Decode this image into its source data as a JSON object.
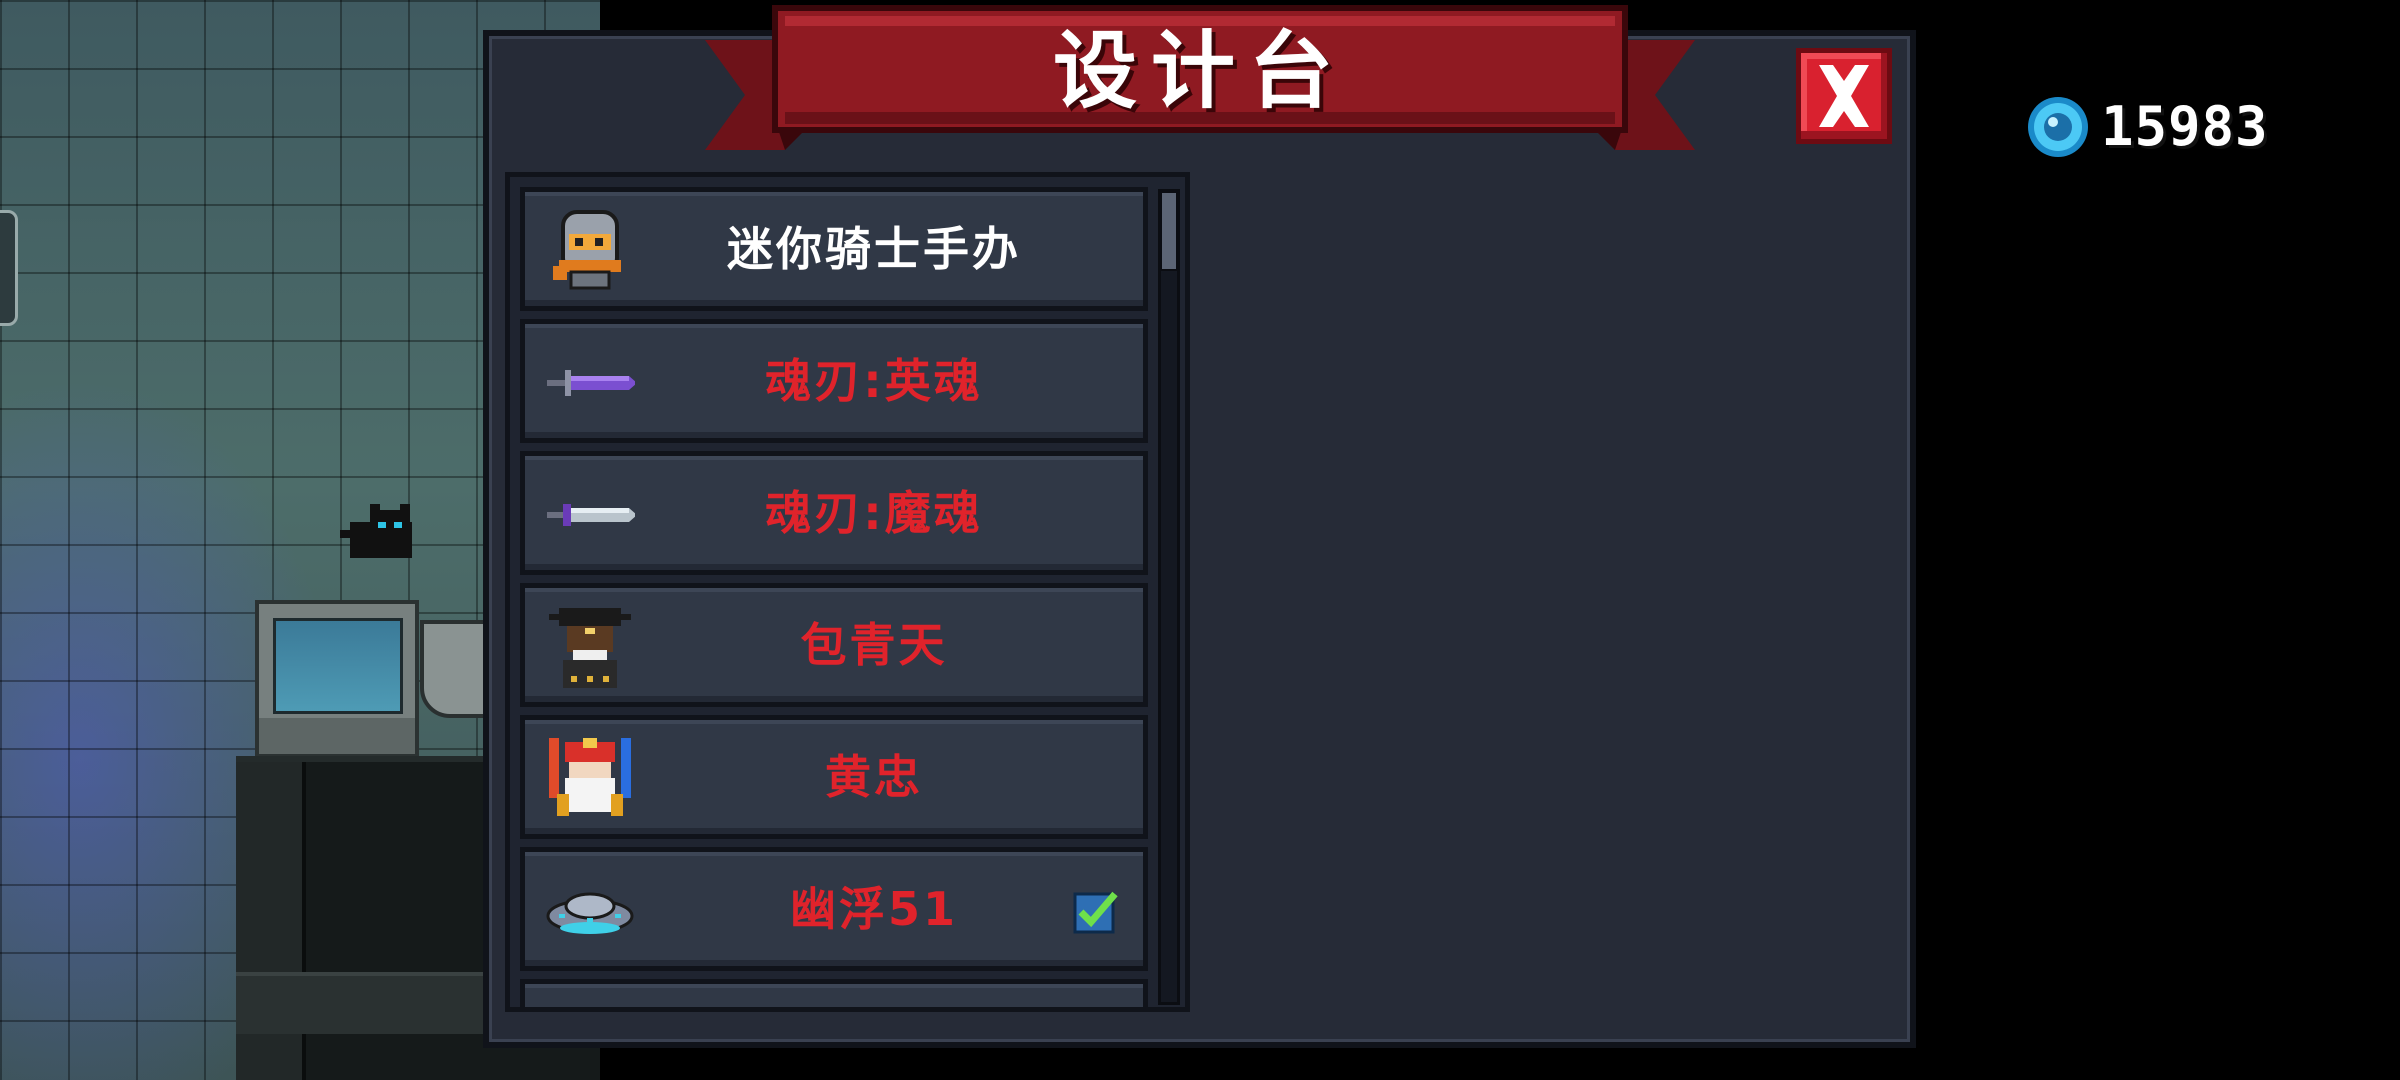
{
  "dialog": {
    "title": "设计台",
    "banner_color": "#8f1a22",
    "close_icon": "close-x-icon"
  },
  "currency": {
    "icon": "blue-gem-icon",
    "amount": "15983"
  },
  "items": [
    {
      "label": "迷你骑士手办",
      "icon": "mini-knight-figure-icon",
      "color": "#ffffff",
      "checked": false
    },
    {
      "label": "魂刃:英魂",
      "icon": "soul-blade-sword-icon",
      "color": "#e0232b",
      "checked": false
    },
    {
      "label": "魂刃:魔魂",
      "icon": "soul-blade-dagger-icon",
      "color": "#e0232b",
      "checked": false
    },
    {
      "label": "包青天",
      "icon": "bao-qingtian-character-icon",
      "color": "#e0232b",
      "checked": false
    },
    {
      "label": "黄忠",
      "icon": "huang-zhong-character-icon",
      "color": "#e0232b",
      "checked": false
    },
    {
      "label": "幽浮51",
      "icon": "ufo-icon",
      "color": "#e0232b",
      "checked": true
    }
  ]
}
